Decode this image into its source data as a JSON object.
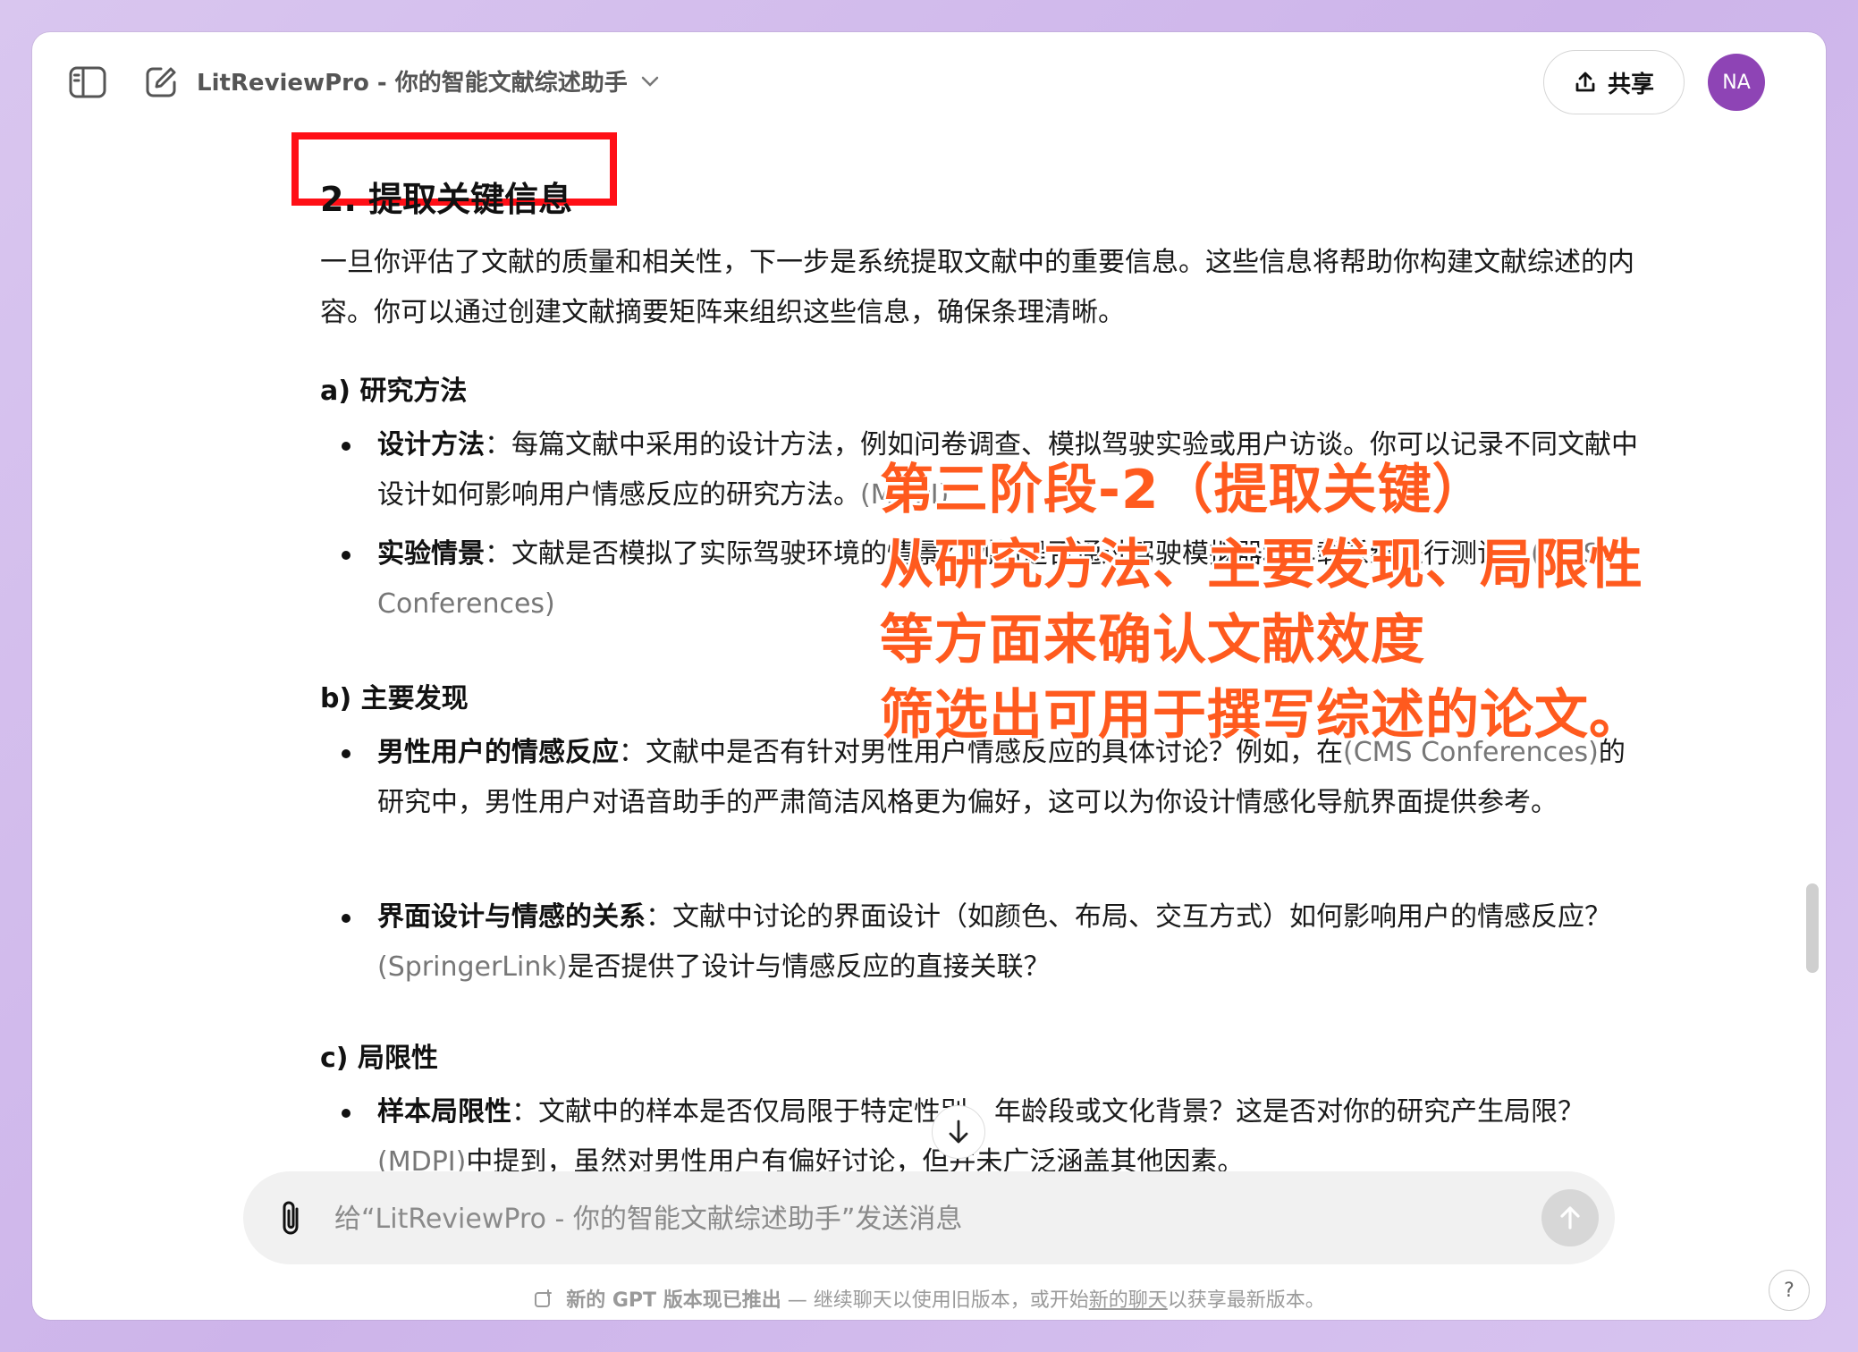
{
  "header": {
    "title": "LitReviewPro - 你的智能文献综述助手",
    "share_label": "共享",
    "avatar_initials": "NA",
    "avatar_color": "#8e44b5"
  },
  "content": {
    "heading": "2. 提取关键信息",
    "intro": "一旦你评估了文献的质量和相关性，下一步是系统提取文献中的重要信息。这些信息将帮助你构建文献综述的内容。你可以通过创建文献摘要矩阵来组织这些信息，确保条理清晰。",
    "sections": [
      {
        "title": "a) 研究方法",
        "bullets": [
          {
            "label": "设计方法",
            "text": "：每篇文献中采用的设计方法，例如问卷调查、模拟驾驶实验或用户访谈。你可以记录不同文献中设计如何影响用户情感反应的研究方法。",
            "cite": "(MDPI)",
            "after": ""
          },
          {
            "label": "实验情景",
            "text": "：文献是否模拟了实际驾驶环境的情景？例如是否通过驾驶模拟器和车载系统进行测试？",
            "cite": "(CMS Conferences)",
            "after": ""
          }
        ]
      },
      {
        "title": "b) 主要发现",
        "bullets": [
          {
            "label": "男性用户的情感反应",
            "text": "：文献中是否有针对男性用户情感反应的具体讨论？例如，在",
            "cite": "(CMS Conferences)",
            "after": "的研究中，男性用户对语音助手的严肃简洁风格更为偏好，这可以为你设计情感化导航界面提供参考。"
          },
          {
            "label": "界面设计与情感的关系",
            "text": "：文献中讨论的界面设计（如颜色、布局、交互方式）如何影响用户的情感反应？",
            "cite": "(SpringerLink)",
            "after": "是否提供了设计与情感反应的直接关联？"
          }
        ]
      },
      {
        "title": "c) 局限性",
        "bullets": [
          {
            "label": "样本局限性",
            "text": "：文献中的样本是否仅局限于特定性别、年龄段或文化背景？这是否对你的研究产生局限？",
            "cite": "(MDPI)",
            "after": "中提到，虽然对男性用户有偏好讨论，但并未广泛涵盖其他因素。"
          }
        ]
      }
    ]
  },
  "overlay": {
    "lines": [
      "第三阶段-2（提取关键）",
      "从研究方法、主要发现、局限性",
      "等方面来确认文献效度",
      "筛选出可用于撰写综述的论文。"
    ],
    "color": "#ff5a1e"
  },
  "composer": {
    "placeholder": "给“LitReviewPro - 你的智能文献综述助手”发送消息"
  },
  "footer": {
    "notice_strong": "新的 GPT 版本现已推出",
    "notice_text": " — 继续聊天以使用旧版本，或开始",
    "link": "新的聊天",
    "notice_end": "以获享最新版本。",
    "help": "?"
  }
}
